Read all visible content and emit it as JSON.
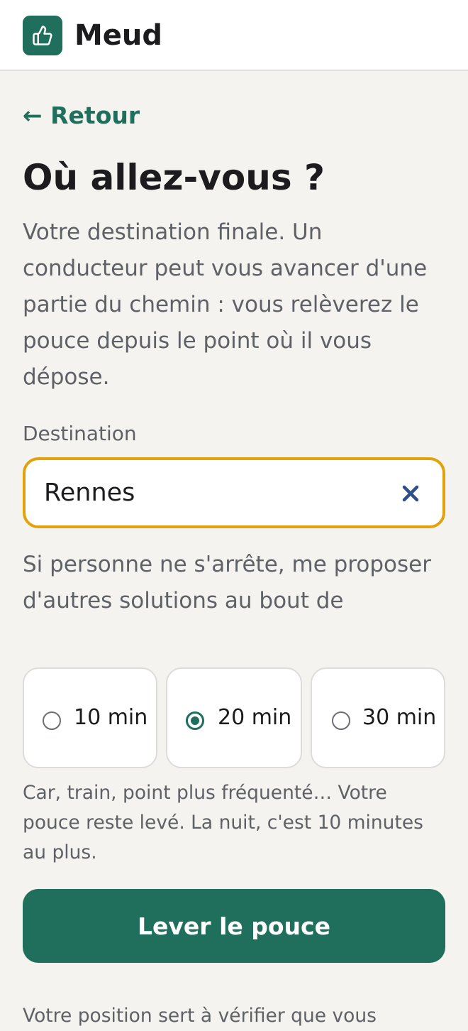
{
  "header": {
    "app_name": "Meud",
    "logo_icon": "thumbs-up-icon"
  },
  "nav": {
    "back_label": "← Retour"
  },
  "page": {
    "title": "Où allez-vous ?",
    "intro": "Votre destination finale. Un conducteur peut vous avancer d'une partie du chemin : vous relèverez le pouce depuis le point où il vous dépose."
  },
  "destination": {
    "label": "Destination",
    "value": "Rennes",
    "clear_icon": "close-icon"
  },
  "fallback": {
    "question": "Si personne ne s'arrête, me proposer d'autres solutions au bout de",
    "options": [
      {
        "label": "10 min",
        "selected": false
      },
      {
        "label": "20 min",
        "selected": true
      },
      {
        "label": "30 min",
        "selected": false
      }
    ],
    "note": "Car, train, point plus fréquenté… Votre pouce reste levé. La nuit, c'est 10 minutes au plus."
  },
  "cta": {
    "label": "Lever le pouce"
  },
  "footer": {
    "note": "Votre position sert à vérifier que vous"
  },
  "colors": {
    "brand": "#1f6f5c",
    "focus_border": "#e1a20e",
    "clear_icon": "#2f4f8a",
    "background": "#f5f3ef"
  }
}
